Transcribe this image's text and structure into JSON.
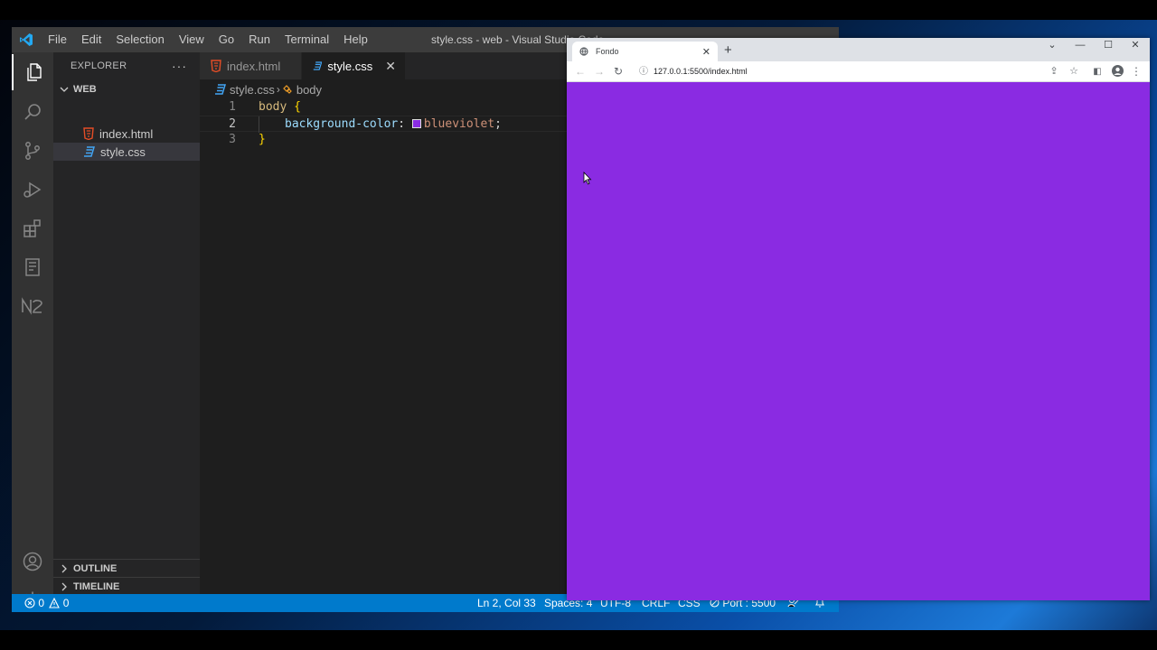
{
  "vscode": {
    "menu": [
      "File",
      "Edit",
      "Selection",
      "View",
      "Go",
      "Run",
      "Terminal",
      "Help"
    ],
    "window_title": "style.css - web - Visual Studio Code",
    "explorer": {
      "title": "EXPLORER",
      "more": "···",
      "folder": "WEB",
      "files": [
        "index.html",
        "style.css"
      ],
      "selected_file": "style.css",
      "sections": [
        "OUTLINE",
        "TIMELINE"
      ]
    },
    "tabs": [
      {
        "label": "index.html",
        "icon": "html-file-icon",
        "active": false
      },
      {
        "label": "style.css",
        "icon": "css-file-icon",
        "active": true
      }
    ],
    "breadcrumb": {
      "file": "style.css",
      "symbol": "body"
    },
    "editor": {
      "line_numbers": [
        "1",
        "2",
        "3"
      ],
      "current_line": 2,
      "line1": {
        "selector": "body",
        "brace": "{"
      },
      "line2": {
        "property": "background-color",
        "colon": ":",
        "value": "blueviolet",
        "semicolon": ";",
        "swatch_color": "#8a2be2"
      },
      "line3": {
        "brace": "}"
      }
    },
    "statusbar": {
      "errors": "0",
      "warnings": "0",
      "position": "Ln 2, Col 33",
      "spaces": "Spaces: 4",
      "encoding": "UTF-8",
      "eol": "CRLF",
      "language": "CSS",
      "port": "Port : 5500"
    },
    "colors": {
      "accent": "#007acc",
      "activity_bar": "#333333",
      "sidebar": "#252526",
      "editor": "#1e1e1e"
    }
  },
  "browser": {
    "tab_title": "Fondo",
    "url": "127.0.0.1:5500/index.html",
    "page_background": "#8a2be2",
    "window_buttons": [
      "⌄",
      "—",
      "☐",
      "✕"
    ]
  }
}
